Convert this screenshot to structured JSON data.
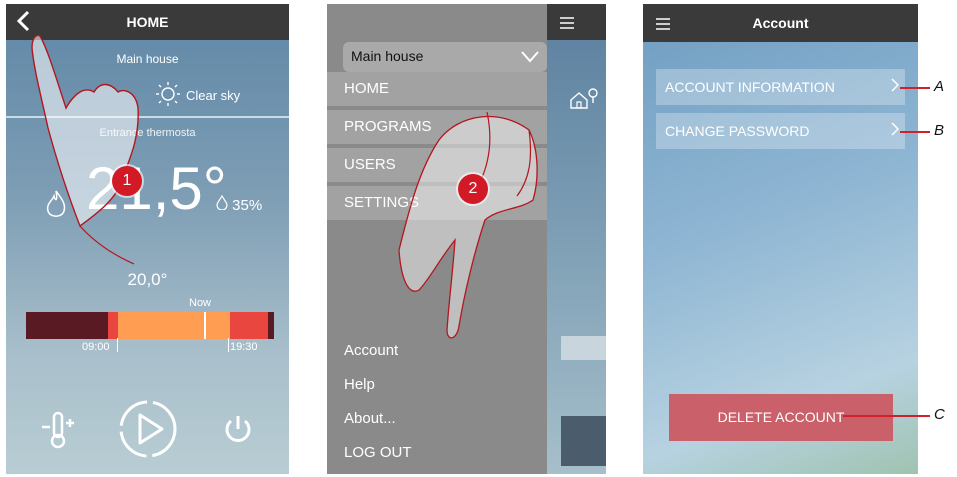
{
  "screen1": {
    "title": "HOME",
    "location": "Main house",
    "weather": "Clear sky",
    "thermostat_name": "Entrance thermosta",
    "temperature": "21,5°",
    "humidity": "35%",
    "setpoint": "20,0°",
    "now_label": "Now",
    "time_start": "09:00",
    "time_end": "19:30",
    "step_badge": "1"
  },
  "screen2": {
    "dropdown_value": "Main house",
    "menu_items": [
      "HOME",
      "PROGRAMS",
      "USERS",
      "SETTINGS"
    ],
    "links": [
      "Account",
      "Help",
      "About...",
      "LOG OUT"
    ],
    "step_badge": "2"
  },
  "screen3": {
    "title": "Account",
    "rows": [
      "ACCOUNT INFORMATION",
      "CHANGE PASSWORD"
    ],
    "delete_label": "DELETE ACCOUNT"
  },
  "callouts": [
    "A",
    "B",
    "C"
  ],
  "colors": {
    "topbar": "#3a3a3a",
    "badge_red": "#d11a26",
    "delete_red": "#c9606a",
    "timeline_dark": "#5a1a24",
    "timeline_orange": "#ff9e52",
    "timeline_red": "#e8463f"
  },
  "icons": [
    "back-arrow-icon",
    "sun-icon",
    "flame-icon",
    "humidity-drop-icon",
    "thermometer-plus-icon",
    "play-icon",
    "power-icon",
    "hamburger-menu-icon",
    "chevron-down-icon",
    "house-location-icon",
    "chevron-right-icon"
  ]
}
